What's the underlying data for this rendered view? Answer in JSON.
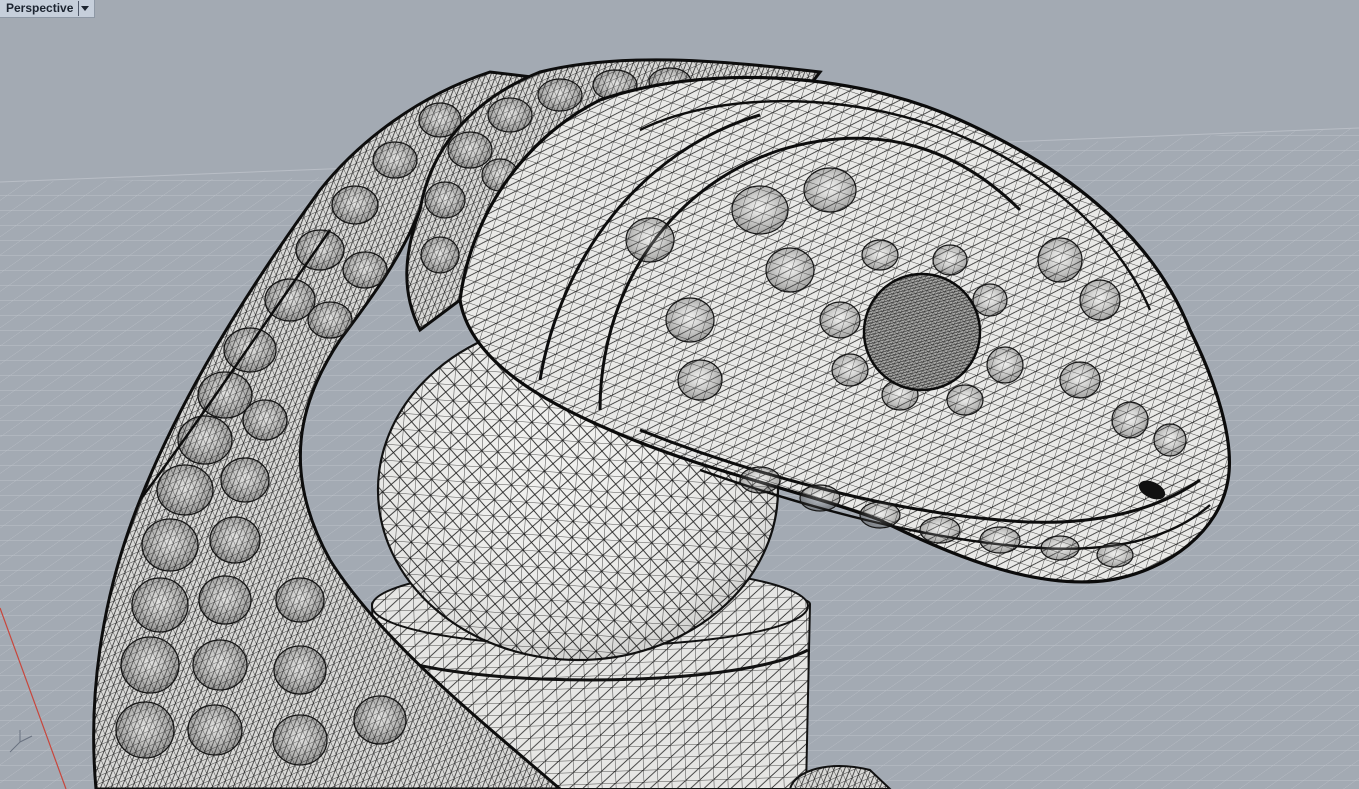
{
  "viewport": {
    "title": "Perspective",
    "menu_icon": "triangle-down-icon",
    "background_color": "#a3aab3",
    "grid_line_color": "#c2c7ce",
    "axis_x_color": "#c8463c",
    "mesh_fill_color": "#ececea",
    "wire_color": "#111111"
  },
  "axis_gizmo": {
    "icon": "axis-gizmo-icon",
    "labels": [
      "z",
      "y",
      "x"
    ]
  }
}
